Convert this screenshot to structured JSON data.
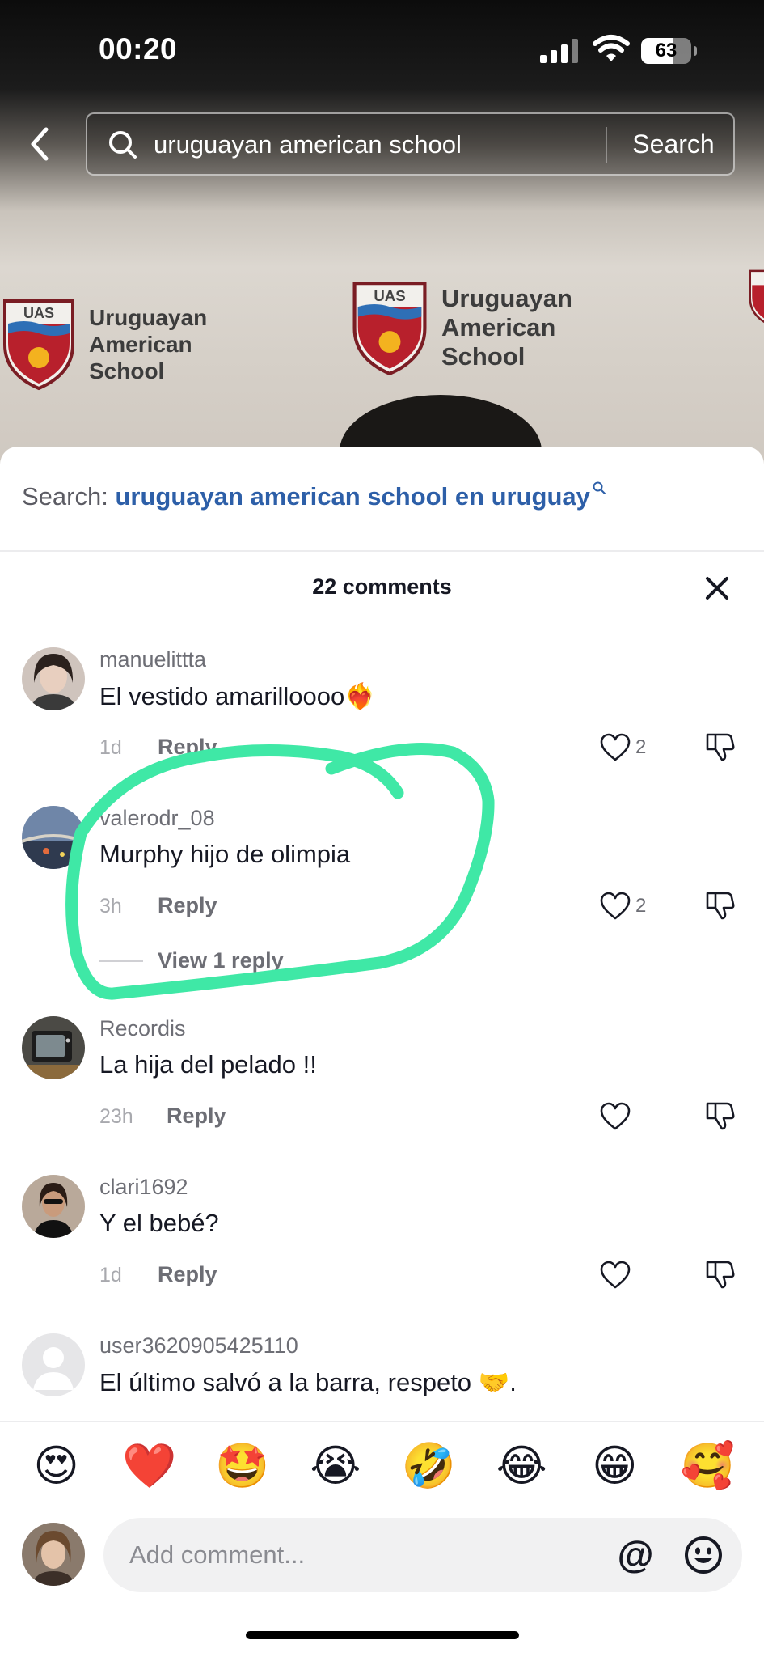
{
  "status_bar": {
    "time": "00:20",
    "battery": "63",
    "battery_level": 0.63
  },
  "search": {
    "query": "uruguayan american school",
    "submit_label": "Search"
  },
  "video": {
    "banner_text": [
      "Uruguayan",
      "American",
      "School"
    ],
    "logo_text": "UAS"
  },
  "sheet": {
    "search_prefix": "Search:",
    "search_suggestion": "uruguayan american school en uruguay",
    "comment_count": "22 comments"
  },
  "comments": [
    {
      "username": "manuelittta",
      "text": "El vestido amarilloooo❤️‍🔥",
      "time": "1d",
      "reply_label": "Reply",
      "likes": "2"
    },
    {
      "username": "valerodr_08",
      "text": "Murphy hijo de olimpia",
      "time": "3h",
      "reply_label": "Reply",
      "likes": "2",
      "view_replies": "View 1 reply"
    },
    {
      "username": "Recordis",
      "text": "La hija del pelado !!",
      "time": "23h",
      "reply_label": "Reply",
      "likes": ""
    },
    {
      "username": "clari1692",
      "text": "Y el bebé?",
      "time": "1d",
      "reply_label": "Reply",
      "likes": ""
    },
    {
      "username": "user3620905425110",
      "text": "El último salvó a la barra, respeto 🤝.",
      "time": "",
      "reply_label": "",
      "likes": ""
    }
  ],
  "emoji_bar": [
    "😍",
    "❤️",
    "🤩",
    "😭",
    "🤣",
    "😂",
    "😁",
    "🥰"
  ],
  "composer": {
    "placeholder": "Add comment...",
    "mention_symbol": "@"
  },
  "colors": {
    "accent_link": "#2d5fa8",
    "annotation": "#3fe8a6",
    "sheet_bg": "#ffffff"
  }
}
